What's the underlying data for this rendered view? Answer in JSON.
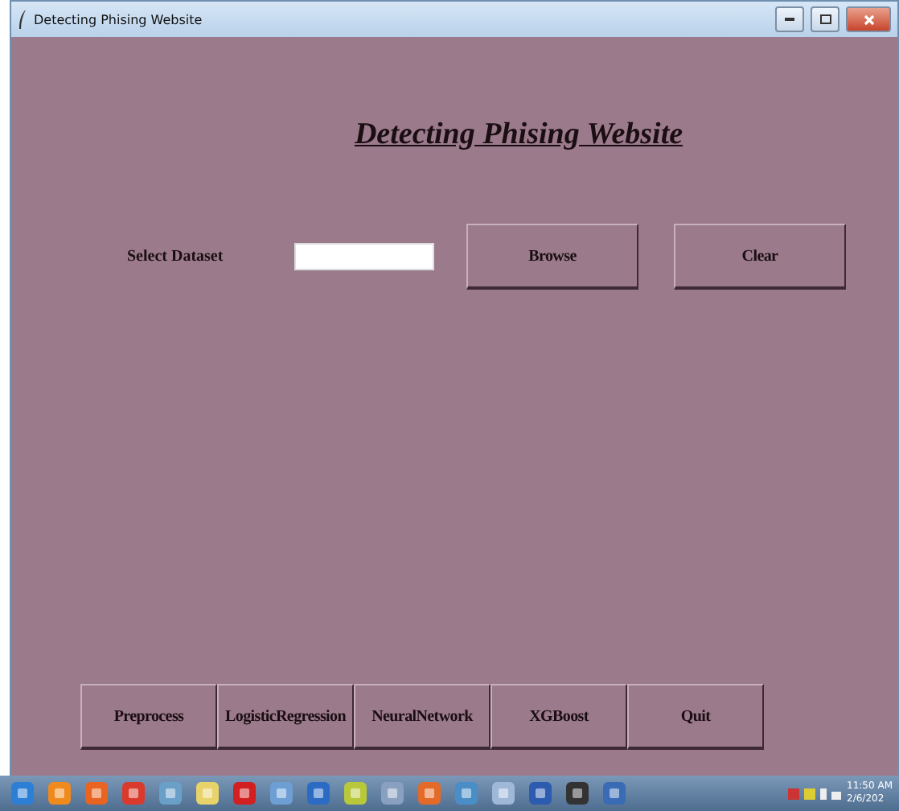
{
  "window": {
    "title": "Detecting Phising Website"
  },
  "heading": "Detecting Phising Website",
  "dataset": {
    "label": "Select Dataset"
  },
  "top_buttons": [
    "Browse",
    "Clear"
  ],
  "bottom_buttons": [
    "Preprocess",
    "LogisticRegression",
    "NeuralNetwork",
    "XGBoost",
    "Quit"
  ],
  "taskbar": {
    "time": "11:50 AM",
    "date": "2/6/202"
  }
}
